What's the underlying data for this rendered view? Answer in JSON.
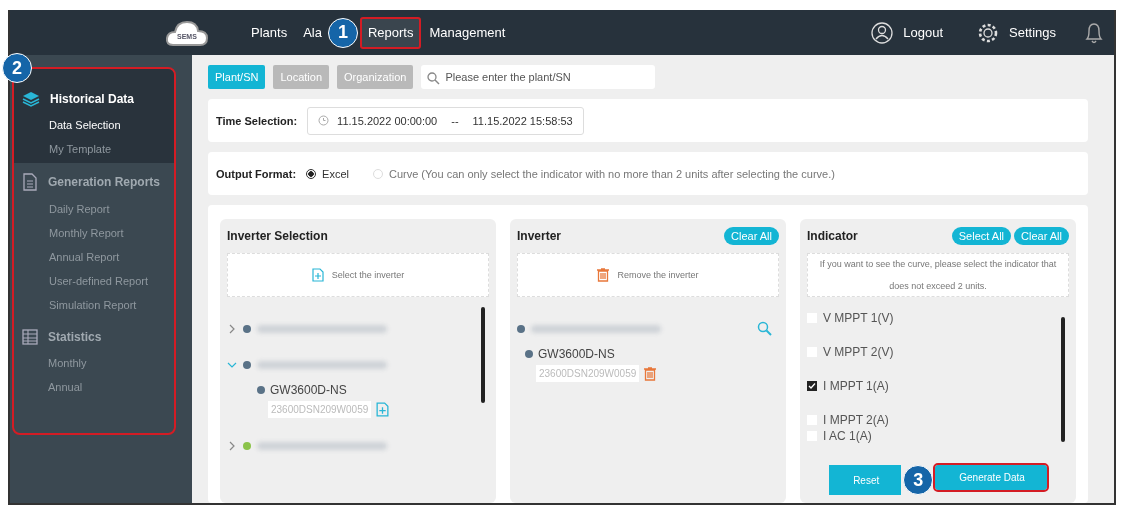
{
  "annotations": [
    {
      "label": "1"
    },
    {
      "label": "2"
    },
    {
      "label": "3"
    }
  ],
  "nav": {
    "logo": "SEMS",
    "items": [
      {
        "label": "Plants",
        "selected": false,
        "highlighted": false
      },
      {
        "label": "Ala",
        "selected": false,
        "highlighted": false
      },
      {
        "label": "Reports",
        "selected": true,
        "highlighted": true
      },
      {
        "label": "Management",
        "selected": false,
        "highlighted": false
      }
    ],
    "logout": "Logout",
    "settings": "Settings"
  },
  "sidebar": {
    "highlighted": true,
    "sections": [
      {
        "title": "Historical Data",
        "kind": "layers",
        "active": true,
        "items": [
          {
            "label": "Data Selection",
            "selected": true
          },
          {
            "label": "My Template",
            "selected": false
          }
        ]
      },
      {
        "title": "Generation Reports",
        "kind": "document",
        "active": false,
        "items": [
          {
            "label": "Daily Report",
            "selected": false
          },
          {
            "label": "Monthly Report",
            "selected": false
          },
          {
            "label": "Annual Report",
            "selected": false
          },
          {
            "label": "User-defined Report",
            "selected": false
          },
          {
            "label": "Simulation Report",
            "selected": false
          }
        ]
      },
      {
        "title": "Statistics",
        "kind": "table",
        "active": false,
        "items": [
          {
            "label": "Monthly",
            "selected": false
          },
          {
            "label": "Annual",
            "selected": false
          }
        ]
      }
    ]
  },
  "filter": {
    "tabs": [
      {
        "label": "Plant/SN",
        "selected": true
      },
      {
        "label": "Location",
        "selected": false
      },
      {
        "label": "Organization",
        "selected": false
      }
    ],
    "search": {
      "placeholder": "Please enter the plant/SN"
    }
  },
  "time_selection": {
    "label": "Time Selection:",
    "start": "11.15.2022 00:00:00",
    "separator": "--",
    "end": "11.15.2022 15:58:53"
  },
  "output_format": {
    "label": "Output Format:",
    "options": [
      {
        "label": "Excel",
        "selected": true
      },
      {
        "label": "Curve (You can only select the indicator with no more than 2 units after selecting the curve.)",
        "selected": false
      }
    ]
  },
  "inverter_selection": {
    "title": "Inverter Selection",
    "hint": "Select the inverter",
    "plants": [
      {
        "expanded": false,
        "color": "#5a7287"
      },
      {
        "expanded": true,
        "color": "#5a7287",
        "children": [
          {
            "model": "GW3600D-NS",
            "serial": "23600DSN209W0059"
          }
        ]
      },
      {
        "expanded": false,
        "color": "#8bc34a"
      }
    ]
  },
  "inverter": {
    "title": "Inverter",
    "clear": "Clear All",
    "hint": "Remove the inverter",
    "plants": [
      {
        "color": "#5a7287",
        "children": [
          {
            "model": "GW3600D-NS",
            "serial": "23600DSN209W0059"
          }
        ]
      }
    ]
  },
  "indicator": {
    "title": "Indicator",
    "select_all": "Select All",
    "clear": "Clear All",
    "hint": "If you want to see the curve, please select the indicator that does not exceed 2 units.",
    "items": [
      {
        "label": "V MPPT 1(V)",
        "checked": false
      },
      {
        "label": "V MPPT 2(V)",
        "checked": false
      },
      {
        "label": "I MPPT 1(A)",
        "checked": true
      },
      {
        "label": "I MPPT 2(A)",
        "checked": false
      },
      {
        "label": "I AC 1(A)",
        "checked": false
      }
    ],
    "reset": "Reset",
    "generate": "Generate Data",
    "generate_highlighted": true
  }
}
